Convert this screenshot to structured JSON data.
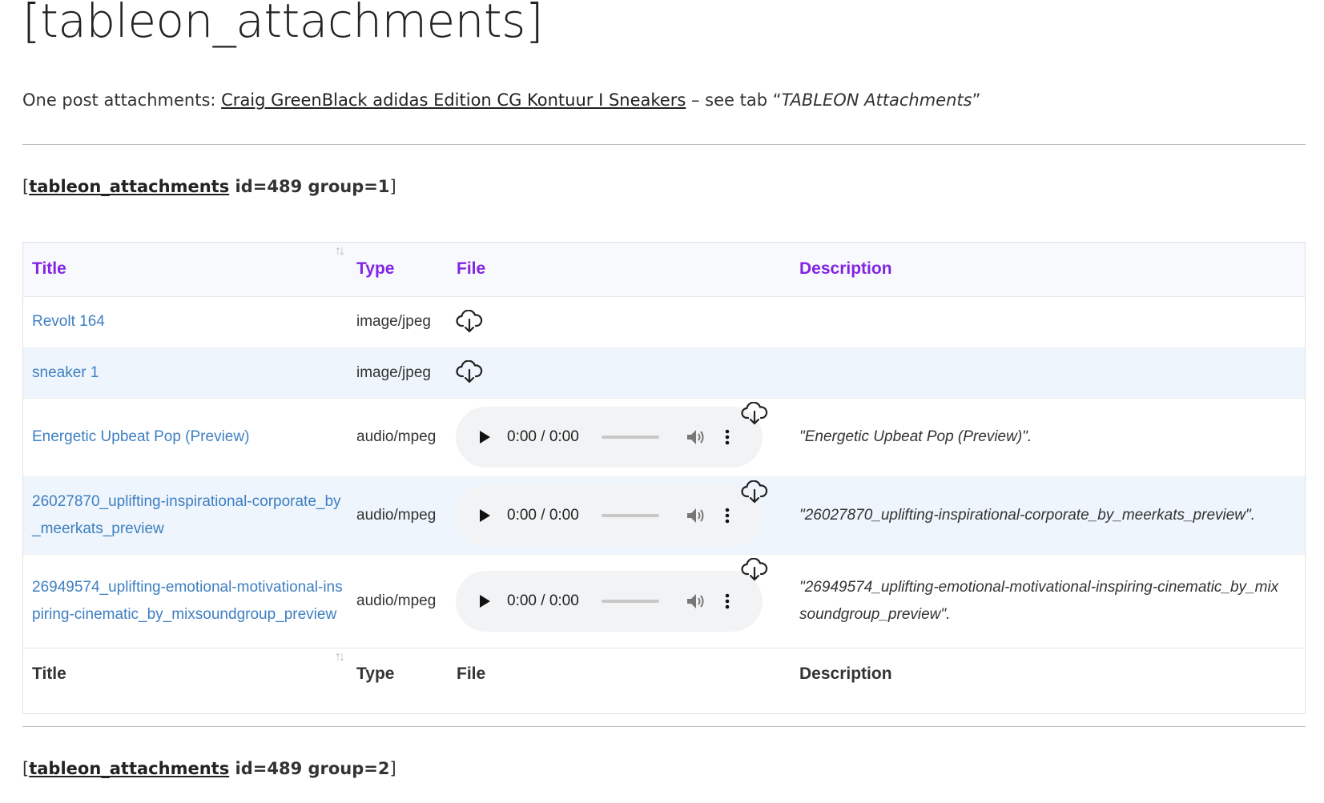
{
  "page": {
    "title": "[tableon_attachments]",
    "intro": {
      "prefix": "One post attachments: ",
      "link_text": "Craig GreenBlack adidas Edition CG Kontuur I Sneakers",
      "middle": " – see tab “",
      "tab_name": "TABLEON Attachments",
      "suffix": "”"
    }
  },
  "shortcodes": [
    {
      "open": "[",
      "tag": "tableon_attachments",
      "args": " id=489 group=1",
      "close": "]"
    },
    {
      "open": "[",
      "tag": "tableon_attachments",
      "args": " id=489 group=2",
      "close": "]"
    }
  ],
  "table": {
    "columns": [
      "Title",
      "Type",
      "File",
      "Description"
    ],
    "rows": [
      {
        "title": "Revolt 164",
        "type": "image/jpeg",
        "file": "download",
        "description": ""
      },
      {
        "title": "sneaker 1",
        "type": "image/jpeg",
        "file": "download",
        "description": ""
      },
      {
        "title": "Energetic Upbeat Pop (Preview)",
        "type": "audio/mpeg",
        "file": "audio",
        "time": "0:00 / 0:00",
        "description": "\"Energetic Upbeat Pop (Preview)\"."
      },
      {
        "title": "26027870_uplifting-inspirational-corporate_by_meerkats_preview",
        "type": "audio/mpeg",
        "file": "audio",
        "time": "0:00 / 0:00",
        "description": "\"26027870_uplifting-inspirational-corporate_by_meerkats_preview\"."
      },
      {
        "title": "26949574_uplifting-emotional-motivational-inspiring-cinematic_by_mixsoundgroup_preview",
        "type": "audio/mpeg",
        "file": "audio",
        "time": "0:00 / 0:00",
        "description": "\"26949574_uplifting-emotional-motivational-inspiring-cinematic_by_mixsoundgroup_preview\"."
      }
    ]
  },
  "colors": {
    "header_text": "#8224e3",
    "link": "#3e7fc1",
    "row_alt": "#eef5fc",
    "player_bg": "#f1f3f4"
  },
  "icons": {
    "download": "cloud-download-icon",
    "sort": "sort-arrows-icon",
    "play": "play-icon",
    "volume": "volume-icon",
    "more": "more-vertical-icon"
  }
}
